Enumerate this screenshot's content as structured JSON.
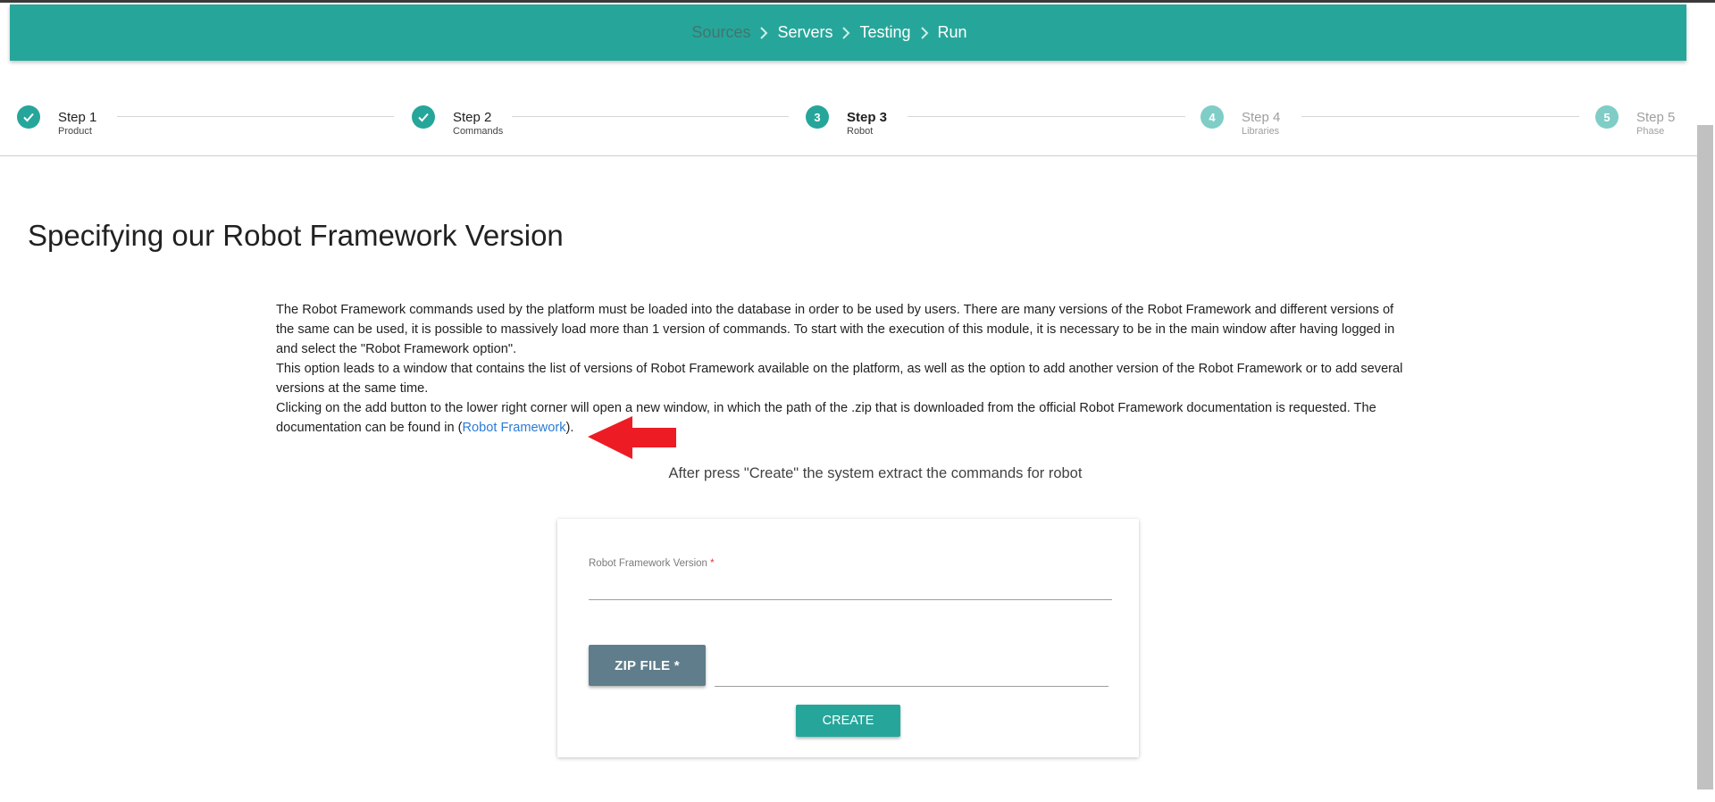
{
  "breadcrumb": [
    {
      "label": "Sources",
      "dim": true
    },
    {
      "label": "Servers",
      "dim": false
    },
    {
      "label": "Testing",
      "dim": false
    },
    {
      "label": "Run",
      "dim": false
    }
  ],
  "stepper": {
    "steps": [
      {
        "number": "1",
        "title": "Step 1",
        "subtitle": "Product",
        "state": "done"
      },
      {
        "number": "2",
        "title": "Step 2",
        "subtitle": "Commands",
        "state": "done"
      },
      {
        "number": "3",
        "title": "Step 3",
        "subtitle": "Robot",
        "state": "active"
      },
      {
        "number": "4",
        "title": "Step 4",
        "subtitle": "Libraries",
        "state": "pending"
      },
      {
        "number": "5",
        "title": "Step 5",
        "subtitle": "Phase",
        "state": "pending"
      }
    ]
  },
  "page": {
    "title": "Specifying our Robot Framework Version",
    "paragraph1": "The Robot Framework commands used by the platform must be loaded into the database in order to be used by users. There are many versions of the Robot Framework and different versions of the same can be used, it is possible to massively load more than 1 version of commands. To start with the execution of this module, it is necessary to be in the main window after having logged in and select the \"Robot Framework option\".",
    "paragraph2": "This option leads to a window that contains the list of versions of Robot Framework available on the platform, as well as the option to add another version of the Robot Framework or to add several versions at the same time.",
    "paragraph3_before": "Clicking on the add button to the lower right corner will open a new window, in which the path of the .zip that is downloaded from the official Robot Framework documentation is requested. The documentation can be found in (",
    "link_text": "Robot Framework",
    "paragraph3_after": ").",
    "after_text": "After press \"Create\" the system extract the commands for robot"
  },
  "form": {
    "version_label": "Robot Framework Version",
    "required_mark": "*",
    "version_value": "",
    "zip_button_label": "ZIP FILE *",
    "create_button_label": "CREATE"
  },
  "colors": {
    "primary": "#26a69a",
    "zip_button": "#607d8b",
    "arrow": "#ed1c24",
    "link": "#2a7bd6"
  },
  "icons": {
    "done": "check-icon",
    "separator": "chevron-right-icon",
    "annotation": "red-arrow-left"
  }
}
